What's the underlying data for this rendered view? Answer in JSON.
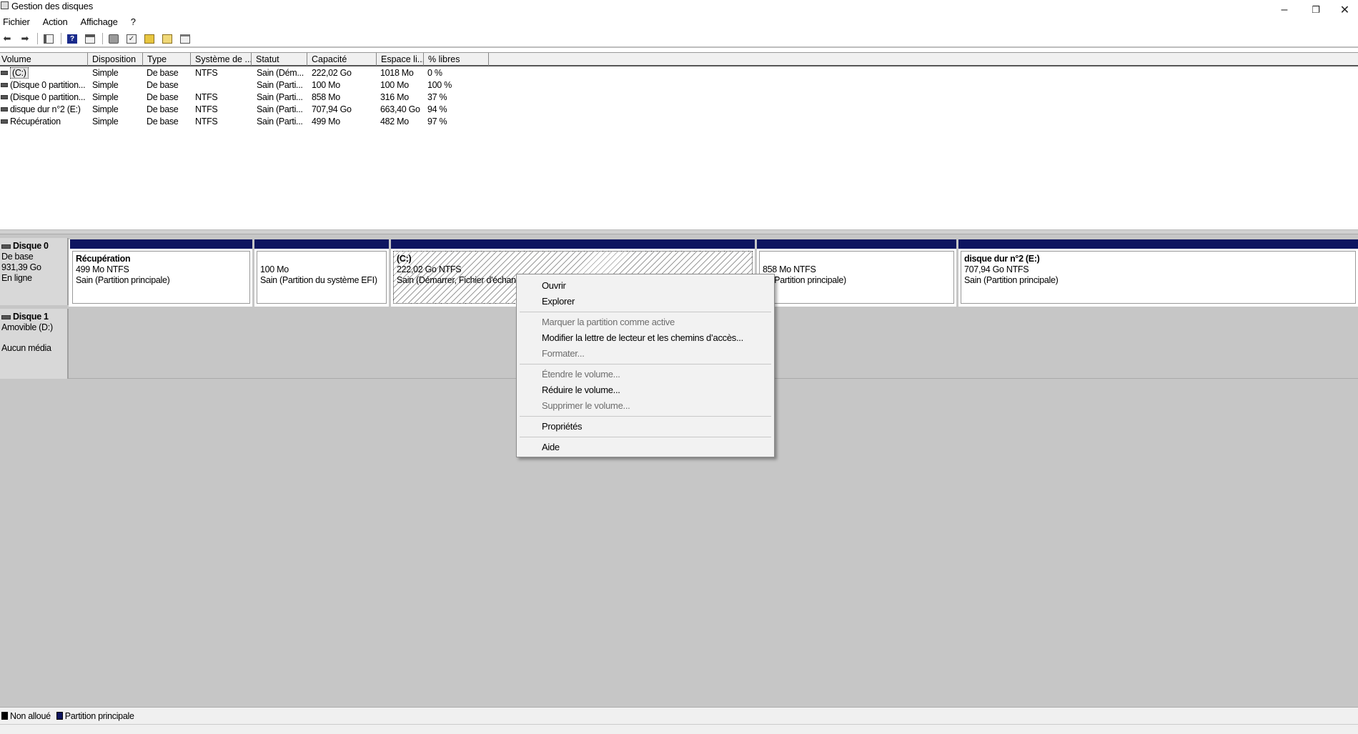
{
  "window": {
    "title": "Gestion des disques",
    "minimize": "–",
    "restore": "❐",
    "close": "✕"
  },
  "menu": [
    "Fichier",
    "Action",
    "Affichage",
    "?"
  ],
  "volume_list": {
    "columns": [
      "Volume",
      "Disposition",
      "Type",
      "Système de ...",
      "Statut",
      "Capacité",
      "Espace li...",
      "% libres"
    ],
    "rows": [
      [
        "(C:)",
        "Simple",
        "De base",
        "NTFS",
        "Sain (Dém...",
        "222,02 Go",
        "1018 Mo",
        "0 %"
      ],
      [
        "(Disque 0 partition...",
        "Simple",
        "De base",
        "",
        "Sain (Parti...",
        "100 Mo",
        "100 Mo",
        "100 %"
      ],
      [
        "(Disque 0 partition...",
        "Simple",
        "De base",
        "NTFS",
        "Sain (Parti...",
        "858 Mo",
        "316 Mo",
        "37 %"
      ],
      [
        "disque dur n°2 (E:)",
        "Simple",
        "De base",
        "NTFS",
        "Sain (Parti...",
        "707,94 Go",
        "663,40 Go",
        "94 %"
      ],
      [
        "Récupération",
        "Simple",
        "De base",
        "NTFS",
        "Sain (Parti...",
        "499 Mo",
        "482 Mo",
        "97 %"
      ]
    ]
  },
  "disks": {
    "disk0": {
      "name": "Disque 0",
      "type": "De base",
      "size": "931,39 Go",
      "state": "En ligne",
      "partitions": [
        {
          "name": "Récupération",
          "size": "499 Mo NTFS",
          "status": "Sain (Partition principale)"
        },
        {
          "name": "",
          "size": "100 Mo",
          "status": "Sain (Partition du système EFI)"
        },
        {
          "name": "(C:)",
          "size": "222,02 Go NTFS",
          "status": "Sain (Démarrer, Fichier d'échan"
        },
        {
          "name": "",
          "size": "858 Mo NTFS",
          "status": "in (Partition principale)"
        },
        {
          "name": "disque dur n°2  (E:)",
          "size": "707,94 Go NTFS",
          "status": "Sain (Partition principale)"
        }
      ]
    },
    "disk1": {
      "name": "Disque 1",
      "type": "Amovible (D:)",
      "state": "Aucun média"
    }
  },
  "legend": {
    "unallocated": "Non alloué",
    "primary": "Partition principale",
    "unallocated_color": "#000000",
    "primary_color": "#0e1560"
  },
  "context_menu": {
    "open": "Ouvrir",
    "explore": "Explorer",
    "mark_active": "Marquer la partition comme active",
    "change_letter": "Modifier la lettre de lecteur et les chemins d’accès...",
    "format": "Formater...",
    "extend": "Étendre le volume...",
    "shrink": "Réduire le volume...",
    "delete": "Supprimer le volume...",
    "properties": "Propriétés",
    "help": "Aide"
  },
  "toolbar_icons": [
    "back-arrow-icon",
    "forward-arrow-icon",
    "console-tree-icon",
    "help-icon",
    "action-pane-icon",
    "connect-icon",
    "check-icon",
    "rescan-icon",
    "attach-icon",
    "properties-icon"
  ]
}
